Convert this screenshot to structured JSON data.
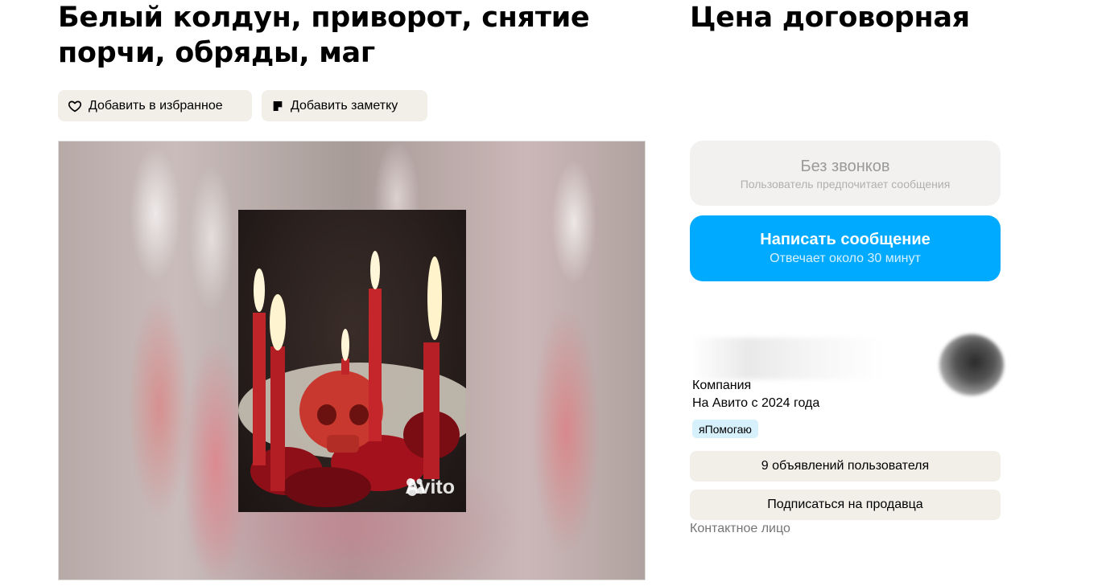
{
  "listing": {
    "title": "Белый колдун, приворот, снятие порчи, обряды, маг",
    "price": "Цена договорная"
  },
  "actions": {
    "favorite_label": "Добавить в избранное",
    "note_label": "Добавить заметку",
    "favorite_icon": "heart-icon",
    "note_icon": "note-icon"
  },
  "gallery": {
    "watermark": "Avito",
    "photo_subject": "red candles and skull"
  },
  "contact": {
    "no_calls_title": "Без звонков",
    "no_calls_subtitle": "Пользователь предпочитает сообщения",
    "message_button": "Написать сообщение",
    "message_reply_time": "Отвечает около 30 минут"
  },
  "seller": {
    "type": "Компания",
    "since": "На Авито с 2024 года",
    "badge": "яПомогаю",
    "ads_button": "9 объявлений пользователя",
    "subscribe_button": "Подписаться на продавца",
    "contact_person_label": "Контактное лицо"
  },
  "colors": {
    "accent_blue": "#00aaff",
    "chip_bg": "#f2efe9",
    "badge_bg": "#d6f0fc"
  }
}
